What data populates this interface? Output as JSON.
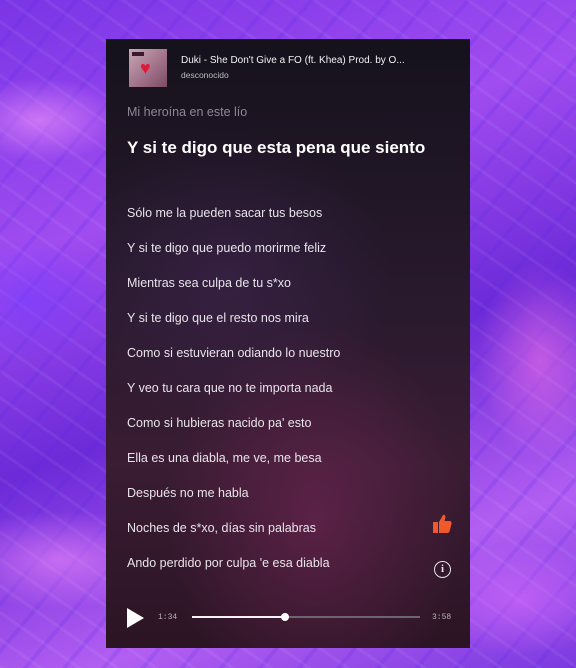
{
  "header": {
    "title": "Duki - She Don't Give a FO (ft. Khea) Prod. by O...",
    "artist": "desconocido"
  },
  "lyrics": {
    "previous": "Mi heroína en este lío",
    "current": "Y si te digo que esta pena que siento",
    "upcoming": [
      "Sólo me la pueden sacar tus besos",
      "Y si te digo que puedo morirme feliz",
      "Mientras sea culpa de tu s*xo",
      "Y si te digo que el resto nos mira",
      "Como si estuvieran odiando lo nuestro",
      "Y veo tu cara que no te importa nada",
      "Como si hubieras nacido pa' esto",
      "Ella es una diabla, me ve, me besa",
      "Después no me habla",
      "Noches de s*xo, días sin palabras",
      "Ando perdido por culpa 'e esa diabla"
    ]
  },
  "player": {
    "elapsed": "1:34",
    "total": "3:58",
    "progress": 0.41
  },
  "icons": {
    "play": "play-icon",
    "like": "thumbs-up-icon",
    "info": "info-icon"
  },
  "colors": {
    "accent_like": "#f05a2a"
  }
}
